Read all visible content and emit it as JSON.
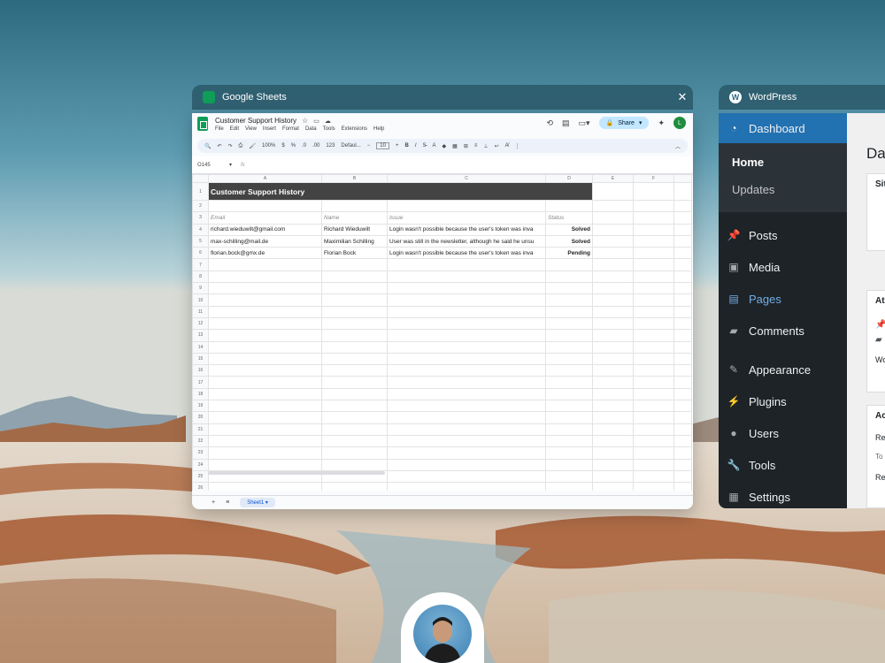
{
  "sheets_window": {
    "app_name": "Google Sheets",
    "close_glyph": "✕",
    "doc_title": "Customer Support History",
    "menu": [
      "File",
      "Edit",
      "View",
      "Insert",
      "Format",
      "Data",
      "Tools",
      "Extensions",
      "Help"
    ],
    "share_label": "Share",
    "user_initial": "L",
    "toolbar": {
      "zoom": "100%",
      "currency": "$",
      "percent": "%",
      "decimal_dec": ".0",
      "decimal_inc": ".00",
      "number_format": "123",
      "font": "Defaul...",
      "font_size": "10",
      "bold": "B",
      "italic": "I"
    },
    "name_box": "O145",
    "fx_label": "fx",
    "columns": [
      "A",
      "B",
      "C",
      "D",
      "E",
      "F"
    ],
    "sheet_title": "Customer Support History",
    "headers": {
      "email": "Email",
      "name": "Name",
      "issue": "Issue",
      "status": "Status"
    },
    "rows": [
      {
        "email": "richard.wieduwilt@gmail.com",
        "name": "Richard Wieduwilt",
        "issue": "Login wasn't possible because the user's token was inva",
        "status": "Solved"
      },
      {
        "email": "max-schilling@mail.de",
        "name": "Maximilian Schilling",
        "issue": "User was still in the newsletter, although he said he unsu",
        "status": "Solved"
      },
      {
        "email": "florian.bock@gmx.de",
        "name": "Florian Bock",
        "issue": "Login wasn't possible because the user's token was inva",
        "status": "Pending"
      }
    ],
    "row_numbers": [
      "1",
      "2",
      "3",
      "4",
      "5",
      "6",
      "7",
      "8",
      "9",
      "10",
      "11",
      "12",
      "13",
      "14",
      "15",
      "16",
      "17",
      "18",
      "19",
      "20",
      "21",
      "22",
      "23",
      "24",
      "25",
      "26"
    ],
    "sheet_tab": "Sheet1",
    "add_sheet": "+",
    "all_sheets": "≡"
  },
  "wp_window": {
    "app_name": "WordPress",
    "menu": {
      "dashboard": "Dashboard",
      "home": "Home",
      "updates": "Updates",
      "posts": "Posts",
      "media": "Media",
      "pages": "Pages",
      "comments": "Comments",
      "appearance": "Appearance",
      "plugins": "Plugins",
      "users": "Users",
      "tools": "Tools",
      "settings": "Settings"
    },
    "main": {
      "heading": "Da",
      "box1": "Sit",
      "box2": "At",
      "box2_line": "Wo",
      "box3": "Ac",
      "box3_line1": "Re",
      "box3_line2": "To",
      "box3_line3": "Re"
    }
  },
  "colors": {
    "wp_sidebar": "#1d2327",
    "wp_active": "#2271b1",
    "sheets_green": "#0f9d58",
    "title_fill": "#434343"
  }
}
